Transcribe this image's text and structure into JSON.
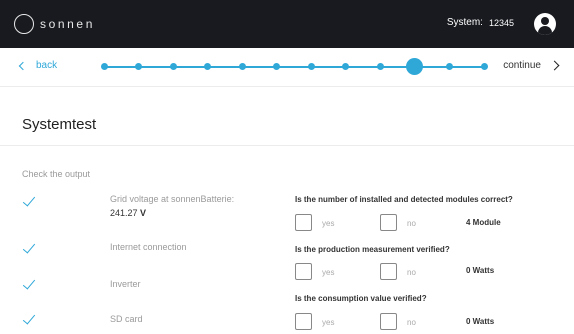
{
  "header": {
    "brand": "sonnen",
    "system_label": "System:",
    "system_id": "12345"
  },
  "nav": {
    "back_label": "back",
    "continue_label": "continue",
    "steps_total": 12,
    "current_step": 10
  },
  "page": {
    "title": "Systemtest",
    "check_heading": "Check the output"
  },
  "checks": [
    {
      "label": "Grid voltage at sonnenBatterie:",
      "value": "241.27",
      "unit": "V",
      "status": "ok"
    },
    {
      "label": "Internet connection",
      "status": "ok"
    },
    {
      "label": "Inverter",
      "status": "ok"
    },
    {
      "label": "SD card",
      "status": "ok"
    }
  ],
  "questions": [
    {
      "text": "Is the number of installed and detected modules correct?",
      "yes_label": "yes",
      "no_label": "no",
      "answer": "4 Module"
    },
    {
      "text": "Is the production measurement verified?",
      "yes_label": "yes",
      "no_label": "no",
      "answer": "0 Watts"
    },
    {
      "text": "Is the consumption value verified?",
      "yes_label": "yes",
      "no_label": "no",
      "answer": "0 Watts"
    }
  ],
  "colors": {
    "accent": "#2fa8d8",
    "header_bg": "#181a1f"
  }
}
